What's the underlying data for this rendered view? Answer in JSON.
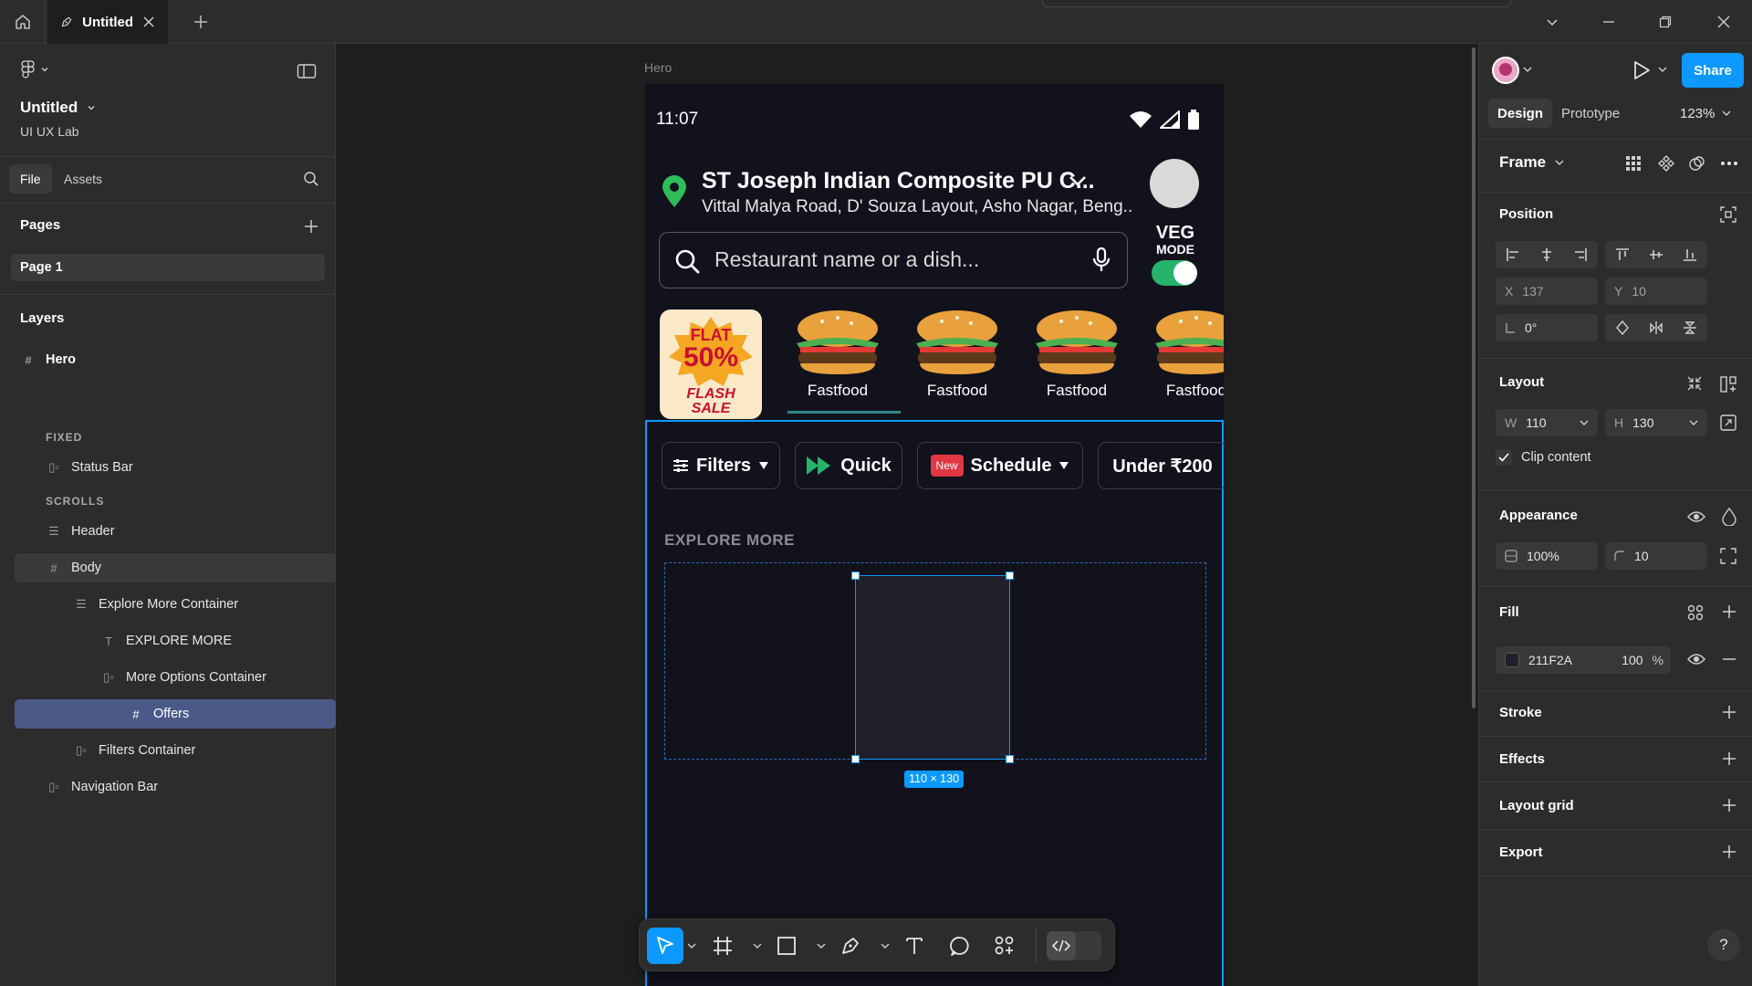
{
  "window": {
    "tab_title": "Untitled"
  },
  "file": {
    "name": "Untitled",
    "team": "UI UX Lab"
  },
  "left_tabs": {
    "file": "File",
    "assets": "Assets"
  },
  "pages": {
    "title": "Pages",
    "items": [
      "Page 1"
    ]
  },
  "layers": {
    "title": "Layers",
    "items": [
      {
        "label": "Hero",
        "icon": "frame-icon"
      },
      {
        "label": "FIXED",
        "group": true
      },
      {
        "label": "Status Bar",
        "icon": "autolayout-icon"
      },
      {
        "label": "SCROLLS",
        "group": true
      },
      {
        "label": "Header",
        "icon": "autolayout-vertical-icon"
      },
      {
        "label": "Body",
        "icon": "frame-icon"
      },
      {
        "label": "Explore More Container",
        "icon": "autolayout-vertical-icon"
      },
      {
        "label": "EXPLORE MORE",
        "icon": "text-icon"
      },
      {
        "label": "More Options Container",
        "icon": "autolayout-icon"
      },
      {
        "label": "Offers",
        "icon": "frame-icon"
      },
      {
        "label": "Filters Container",
        "icon": "autolayout-icon"
      },
      {
        "label": "Navigation Bar",
        "icon": "autolayout-icon"
      }
    ]
  },
  "canvas": {
    "frame_label": "Hero",
    "selection_size": "110 × 130",
    "phone": {
      "time": "11:07",
      "location_title": "ST Joseph Indian Composite PU C...",
      "location_address": "Vittal Malya Road, D' Souza Layout, Asho Nagar, Beng..",
      "search_placeholder": "Restaurant name or a dish...",
      "veg_label_1": "VEG",
      "veg_label_2": "MODE",
      "sale_line1": "FLAT",
      "sale_line2": "50%",
      "sale_line3": "FLASH",
      "sale_line4": "SALE",
      "categories": [
        "Fastfood",
        "Fastfood",
        "Fastfood",
        "Fastfood"
      ],
      "chips": {
        "filters": "Filters",
        "quick": "Quick",
        "new_badge": "New",
        "schedule": "Schedule",
        "under": "Under ₹200"
      },
      "explore_title": "EXPLORE MORE"
    }
  },
  "right": {
    "tabs": {
      "design": "Design",
      "prototype": "Prototype"
    },
    "zoom": "123%",
    "share": "Share",
    "frame_label": "Frame",
    "position": {
      "title": "Position",
      "x_label": "X",
      "x": "137",
      "y_label": "Y",
      "y": "10",
      "rotation": "0°"
    },
    "layout": {
      "title": "Layout",
      "w_label": "W",
      "w": "110",
      "h_label": "H",
      "h": "130",
      "clip": "Clip content"
    },
    "appearance": {
      "title": "Appearance",
      "opacity": "100%",
      "radius": "10"
    },
    "fill": {
      "title": "Fill",
      "hex": "211F2A",
      "opacity": "100",
      "percent": "%"
    },
    "stroke": "Stroke",
    "effects": "Effects",
    "layout_grid": "Layout grid",
    "export": "Export",
    "help": "?"
  },
  "colors": {
    "accent": "#0d99ff",
    "selected_layer": "#4a5987",
    "phone_bg": "#12121c",
    "fill_swatch": "#211F2A",
    "toggle_green": "#26b36a",
    "pin_green": "#2ebd59"
  }
}
